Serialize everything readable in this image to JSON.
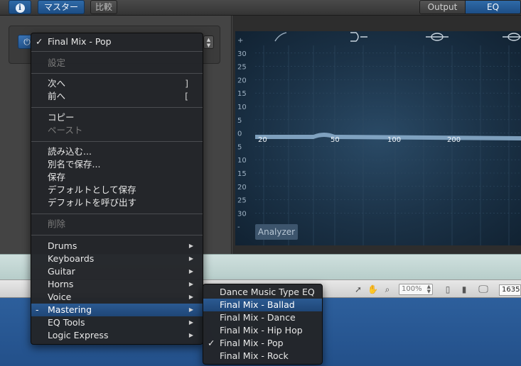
{
  "toolbar": {
    "info_icon": "i",
    "master_label": "マスター",
    "compare_label": "比較",
    "output_tab": "Output",
    "eq_tab": "EQ"
  },
  "preset": {
    "power_icon": "power-icon",
    "power_glyph": "⏻",
    "current": "Final Mix - Pop"
  },
  "eq": {
    "db_labels": [
      "+",
      "30",
      "25",
      "20",
      "15",
      "10",
      "5",
      "0",
      "5",
      "10",
      "15",
      "20",
      "25",
      "30",
      "-"
    ],
    "freq_labels": [
      "20",
      "50",
      "100",
      "200"
    ],
    "analyzer_label": "Analyzer",
    "colors": {
      "curve": "#8fb3d1",
      "grid": "#2f4a62",
      "label": "#9fb2c3"
    }
  },
  "status_bar": {
    "zoom_value": "100%",
    "number_value": "1635"
  },
  "main_menu": {
    "current": "Final Mix - Pop",
    "settings": "設定",
    "next": "次へ",
    "next_key": "]",
    "prev": "前へ",
    "prev_key": "[",
    "copy": "コピー",
    "paste": "ペースト",
    "load": "読み込む...",
    "save_as": "別名で保存...",
    "save": "保存",
    "save_default": "デフォルトとして保存",
    "recall_default": "デフォルトを呼び出す",
    "delete": "削除",
    "categories": [
      "Drums",
      "Keyboards",
      "Guitar",
      "Horns",
      "Voice",
      "Mastering",
      "EQ Tools",
      "Logic Express"
    ],
    "active_category_marker": "-"
  },
  "sub_menu": {
    "items": [
      "Dance Music Type EQ",
      "Final Mix - Ballad",
      "Final Mix - Dance",
      "Final Mix - Hip Hop",
      "Final Mix - Pop",
      "Final Mix - Rock"
    ],
    "checked_mark": "✓"
  }
}
